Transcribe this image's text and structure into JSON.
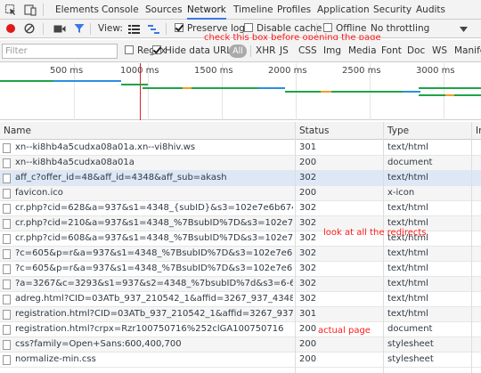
{
  "tabs": [
    "Elements",
    "Console",
    "Sources",
    "Network",
    "Timeline",
    "Profiles",
    "Application",
    "Security",
    "Audits"
  ],
  "active_tab": "Network",
  "toolbar": {
    "view_label": "View:",
    "preserve_log": "Preserve log",
    "disable_cache": "Disable cache",
    "offline": "Offline",
    "throttling": "No throttling"
  },
  "filter": {
    "placeholder": "Filter",
    "regex": "Regex",
    "hide_data_urls": "Hide data URLs",
    "all": "All",
    "types": [
      "XHR",
      "JS",
      "CSS",
      "Img",
      "Media",
      "Font",
      "Doc",
      "WS",
      "Manife"
    ]
  },
  "annotations": {
    "check_box": "check this box before opening the page",
    "redirects": "look at all the redirects",
    "actual_page": "actual page"
  },
  "overview_ticks": [
    "500 ms",
    "1000 ms",
    "1500 ms",
    "2000 ms",
    "2500 ms",
    "3000 ms"
  ],
  "columns": {
    "name": "Name",
    "status": "Status",
    "type": "Type",
    "initiator": "In"
  },
  "rows": [
    {
      "name": "xn--ki8hb4a5cudxa08a01a.xn--vi8hiv.ws",
      "status": "301",
      "type": "text/html"
    },
    {
      "name": "xn--ki8hb4a5cudxa08a01a",
      "status": "200",
      "type": "document"
    },
    {
      "name": "aff_c?offer_id=48&aff_id=4348&aff_sub=akash",
      "status": "302",
      "type": "text/html"
    },
    {
      "name": "favicon.ico",
      "status": "200",
      "type": "x-icon"
    },
    {
      "name": "cr.php?cid=628&a=937&s1=4348_{subID}&s3=102e7e6b6742b85cff129349...",
      "status": "302",
      "type": "text/html"
    },
    {
      "name": "cr.php?cid=210&a=937&s1=4348_%7BsubID%7D&s3=102e7e6b6742b85cf...",
      "status": "302",
      "type": "text/html"
    },
    {
      "name": "cr.php?cid=608&a=937&s1=4348_%7BsubID%7D&s3=102e7e6b6742b85cf...",
      "status": "302",
      "type": "text/html"
    },
    {
      "name": "?c=605&p=r&a=937&s1=4348_%7BsubID%7D&s3=102e7e6b6742b85cff12...",
      "status": "302",
      "type": "text/html"
    },
    {
      "name": "?c=605&p=r&a=937&s1=4348_%7BsubID%7D&s3=102e7e6b6742b85cff12...",
      "status": "302",
      "type": "text/html"
    },
    {
      "name": "?a=3267&c=3293&s1=937&s2=4348_%7bsubID%7d&s3=6-610-4364ba69-...",
      "status": "302",
      "type": "text/html"
    },
    {
      "name": "adreg.html?CID=03ATb_937_210542_1&affid=3267_937_4348_%7bsubID%7...",
      "status": "302",
      "type": "text/html"
    },
    {
      "name": "registration.html?CID=03ATb_937_210542_1&affid=3267_937_4348_%257bs...",
      "status": "301",
      "type": "text/html"
    },
    {
      "name": "registration.html?crpx=Rzr100750716%252clGA100750716",
      "status": "200",
      "type": "document"
    },
    {
      "name": "css?family=Open+Sans:600,400,700",
      "status": "200",
      "type": "stylesheet"
    },
    {
      "name": "normalize-min.css",
      "status": "200",
      "type": "stylesheet"
    }
  ]
}
